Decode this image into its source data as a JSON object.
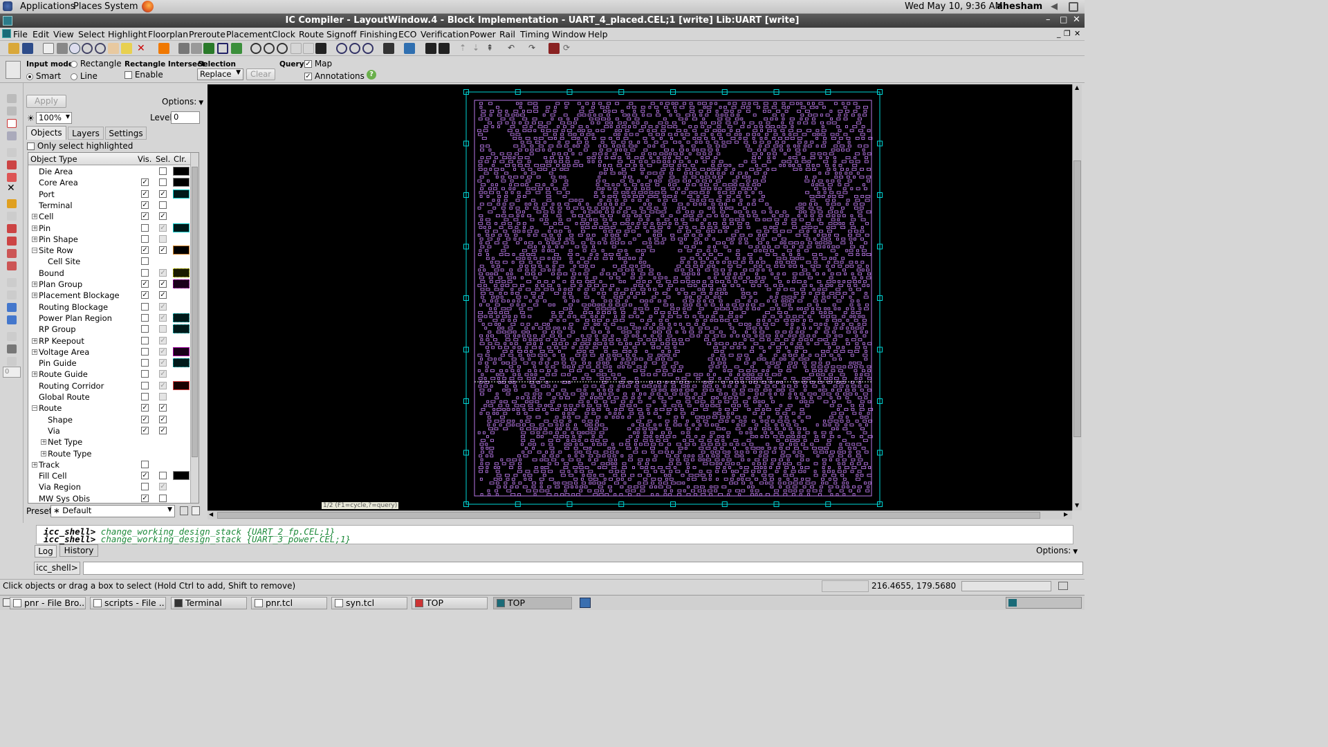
{
  "gnome_panel": {
    "applications": "Applications",
    "places": "Places",
    "system": "System",
    "datetime": "Wed May 10,  9:36 AM",
    "user": "ahesham"
  },
  "window": {
    "title": "IC Compiler - LayoutWindow.4 - Block Implementation - UART_4_placed.CEL;1 [write]    Lib:UART [write]"
  },
  "menu": [
    "File",
    "Edit",
    "View",
    "Select",
    "Highlight",
    "Floorplan",
    "Preroute",
    "Placement",
    "Clock",
    "Route",
    "Signoff",
    "Finishing",
    "ECO",
    "Verification",
    "Power",
    "Rail",
    "Timing",
    "Window",
    "Help"
  ],
  "options_bar": {
    "input_mode_label": "Input mode",
    "smart": "Smart",
    "rectangle": "Rectangle",
    "line": "Line",
    "rect_intersect_label": "Rectangle Intersect",
    "enable": "Enable",
    "selection_label": "Selection",
    "selection_value": "Replace",
    "clear": "Clear",
    "query_label": "Query",
    "map": "Map",
    "annotations": "Annotations",
    "help": "?"
  },
  "panel": {
    "apply": "Apply",
    "options": "Options:",
    "zoom": "100%",
    "level_label": "Level",
    "level_value": "0",
    "tabs": [
      "Objects",
      "Layers",
      "Settings"
    ],
    "only_select_highlighted": "Only select highlighted",
    "headers": {
      "object_type": "Object Type",
      "vis": "Vis.",
      "sel": "Sel.",
      "clr": "Clr."
    },
    "rows": [
      {
        "name": "Die Area",
        "indent": 0,
        "exp": "",
        "vis": "none",
        "sel": "off",
        "color": "#000000",
        "border": "#888888"
      },
      {
        "name": "Core Area",
        "indent": 0,
        "exp": "",
        "vis": "on",
        "sel": "off",
        "color": "#000000",
        "border": "#888888"
      },
      {
        "name": "Port",
        "indent": 0,
        "exp": "",
        "vis": "on",
        "sel": "on",
        "color": "#001a1a",
        "border": "#00c8c8"
      },
      {
        "name": "Terminal",
        "indent": 0,
        "exp": "",
        "vis": "on",
        "sel": "off",
        "color": "",
        "border": ""
      },
      {
        "name": "Cell",
        "indent": 0,
        "exp": "+",
        "vis": "on",
        "sel": "on",
        "color": "",
        "border": ""
      },
      {
        "name": "Pin",
        "indent": 0,
        "exp": "+",
        "vis": "off",
        "sel": "dison",
        "color": "#001a1a",
        "border": "#00c8c8"
      },
      {
        "name": "Pin Shape",
        "indent": 0,
        "exp": "+",
        "vis": "off",
        "sel": "dis",
        "color": "",
        "border": ""
      },
      {
        "name": "Site Row",
        "indent": 0,
        "exp": "-",
        "vis": "on",
        "sel": "on",
        "color": "#000000",
        "border": "#d08020"
      },
      {
        "name": "Cell Site",
        "indent": 1,
        "exp": "",
        "vis": "off",
        "sel": "none",
        "color": "",
        "border": ""
      },
      {
        "name": "Bound",
        "indent": 0,
        "exp": "",
        "vis": "off",
        "sel": "dison",
        "color": "#1a1a00",
        "border": "#e8e800",
        "dotted": true
      },
      {
        "name": "Plan Group",
        "indent": 0,
        "exp": "+",
        "vis": "on",
        "sel": "on",
        "color": "#1a001a",
        "border": "#d000d0",
        "dotted": true
      },
      {
        "name": "Placement Blockage",
        "indent": 0,
        "exp": "+",
        "vis": "on",
        "sel": "on",
        "color": "",
        "border": ""
      },
      {
        "name": "Routing Blockage",
        "indent": 0,
        "exp": "",
        "vis": "off",
        "sel": "dison",
        "color": "",
        "border": ""
      },
      {
        "name": "Power Plan Region",
        "indent": 0,
        "exp": "",
        "vis": "off",
        "sel": "dison",
        "color": "#001a1a",
        "border": "#00c8c8",
        "dotted": true
      },
      {
        "name": "RP Group",
        "indent": 0,
        "exp": "",
        "vis": "off",
        "sel": "dis",
        "color": "#001a1a",
        "border": "#00c8c8",
        "dotted": true
      },
      {
        "name": "RP Keepout",
        "indent": 0,
        "exp": "+",
        "vis": "off",
        "sel": "dison",
        "color": "",
        "border": ""
      },
      {
        "name": "Voltage Area",
        "indent": 0,
        "exp": "+",
        "vis": "off",
        "sel": "dison",
        "color": "#1a001a",
        "border": "#a000a0"
      },
      {
        "name": "Pin Guide",
        "indent": 0,
        "exp": "",
        "vis": "off",
        "sel": "dison",
        "color": "#001a1a",
        "border": "#00c8c8",
        "dotted": true
      },
      {
        "name": "Route Guide",
        "indent": 0,
        "exp": "+",
        "vis": "off",
        "sel": "dison",
        "color": "",
        "border": ""
      },
      {
        "name": "Routing Corridor",
        "indent": 0,
        "exp": "",
        "vis": "off",
        "sel": "dison",
        "color": "#1a0000",
        "border": "#e04040"
      },
      {
        "name": "Global Route",
        "indent": 0,
        "exp": "",
        "vis": "off",
        "sel": "dis",
        "color": "",
        "border": ""
      },
      {
        "name": "Route",
        "indent": 0,
        "exp": "-",
        "vis": "on",
        "sel": "on",
        "color": "",
        "border": ""
      },
      {
        "name": "Shape",
        "indent": 1,
        "exp": "",
        "vis": "on",
        "sel": "on",
        "color": "",
        "border": ""
      },
      {
        "name": "Via",
        "indent": 1,
        "exp": "",
        "vis": "on",
        "sel": "on",
        "color": "",
        "border": ""
      },
      {
        "name": "Net Type",
        "indent": 1,
        "exp": "+",
        "vis": "none",
        "sel": "none",
        "color": "",
        "border": ""
      },
      {
        "name": "Route Type",
        "indent": 1,
        "exp": "+",
        "vis": "none",
        "sel": "none",
        "color": "",
        "border": ""
      },
      {
        "name": "Track",
        "indent": 0,
        "exp": "+",
        "vis": "off",
        "sel": "none",
        "color": "",
        "border": ""
      },
      {
        "name": "Fill Cell",
        "indent": 0,
        "exp": "",
        "vis": "on",
        "sel": "off",
        "color": "#000000",
        "border": "#888888"
      },
      {
        "name": "Via Region",
        "indent": 0,
        "exp": "",
        "vis": "off",
        "sel": "dison",
        "color": "",
        "border": ""
      },
      {
        "name": "MW Sys Obis",
        "indent": 0,
        "exp": "",
        "vis": "on",
        "sel": "off",
        "color": "",
        "border": ""
      }
    ],
    "preset_label": "Preset",
    "preset_value": "∗ Default"
  },
  "canvas": {
    "hint": "1/2 (F1=cycle,?=query)",
    "cell_color": "#b978e8",
    "port_color": "#00d8d8"
  },
  "console": {
    "lines": [
      {
        "prompt": "icc_shell>",
        "cmd": "change_working_design_stack {UART_2_fp.CEL;1}"
      },
      {
        "prompt": "icc_shell>",
        "cmd": "change_working_design_stack {UART_3_power.CEL;1}"
      }
    ],
    "tabs": [
      "Log",
      "History"
    ],
    "options": "Options:",
    "prompt_label": "icc_shell>"
  },
  "status": {
    "message": "Click objects or drag a box to select (Hold Ctrl to add, Shift to remove)",
    "coords": "216.4655, 179.5680"
  },
  "taskbar": [
    "pnr - File Bro...",
    "scripts - File ...",
    "Terminal",
    "pnr.tcl",
    "syn.tcl",
    "TOP",
    "TOP"
  ]
}
